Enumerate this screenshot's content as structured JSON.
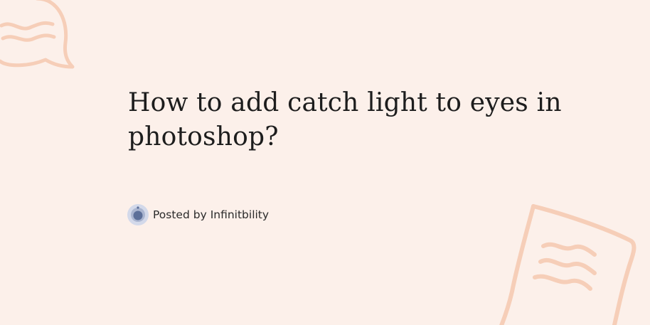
{
  "post": {
    "title": "How to add catch light to eyes in photoshop?",
    "posted_by_prefix": "Posted by",
    "author_name": "Infinitbility"
  },
  "colors": {
    "background": "#fcf0ea",
    "decoration": "#f6c9b0",
    "avatar_ring": "#d3d9ea",
    "avatar_core": "#5c6f99"
  },
  "icons": {
    "avatar": "avatar-icon",
    "decorations": [
      "speech-bubble-squiggle-icon",
      "note-squiggle-icon"
    ]
  }
}
